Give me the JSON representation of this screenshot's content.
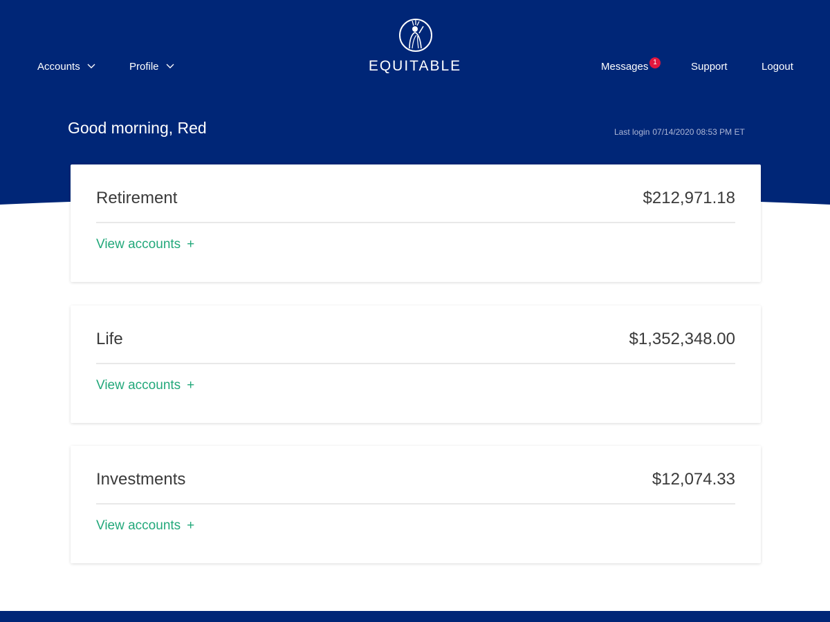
{
  "nav": {
    "accounts_label": "Accounts",
    "profile_label": "Profile",
    "messages_label": "Messages",
    "messages_badge": "1",
    "support_label": "Support",
    "logout_label": "Logout"
  },
  "brand": {
    "name": "EQUITABLE",
    "logo_icon": "lady-liberty-logo-icon"
  },
  "greeting": "Good morning, Red",
  "last_login": {
    "label": "Last login",
    "value": "07/14/2020 08:53 PM ET"
  },
  "cards": [
    {
      "title": "Retirement",
      "amount": "$212,971.18",
      "link_label": "View accounts",
      "link_icon": "+"
    },
    {
      "title": "Life",
      "amount": "$1,352,348.00",
      "link_label": "View accounts",
      "link_icon": "+"
    },
    {
      "title": "Investments",
      "amount": "$12,074.33",
      "link_label": "View accounts",
      "link_icon": "+"
    }
  ],
  "colors": {
    "brand_navy": "#002677",
    "link_green": "#22a87a",
    "badge_red": "#e3173e",
    "text_dark": "#3a3a3a",
    "background": "#ffffff"
  }
}
